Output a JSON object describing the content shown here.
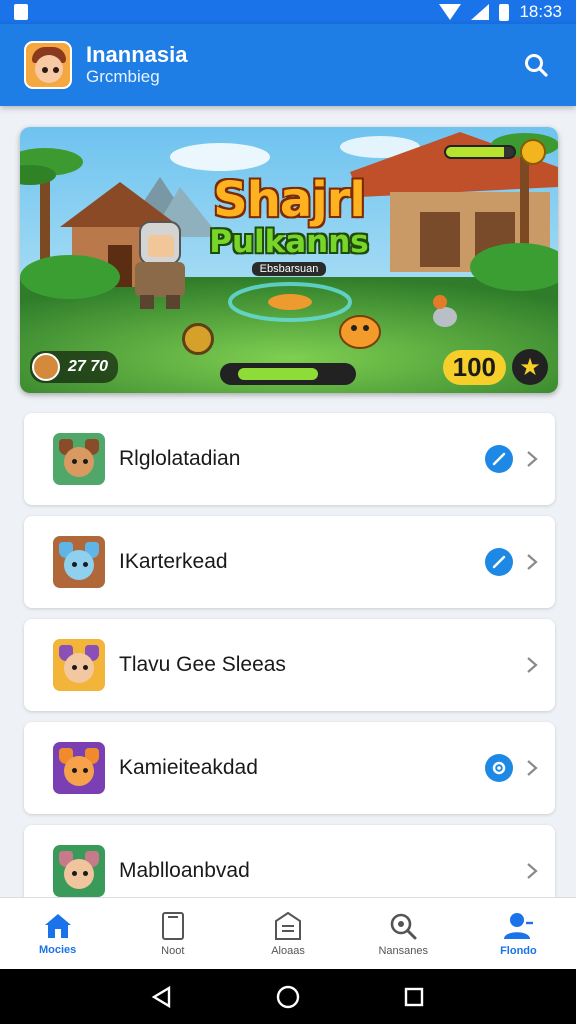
{
  "status_bar": {
    "time": "18:33"
  },
  "app_bar": {
    "title": "Inannasia",
    "subtitle": "Grcmbieg"
  },
  "banner": {
    "title": "Shajrl",
    "subtitle": "Pulkanns",
    "tag": "Ebsbarsuan",
    "hud_left_value": "27 70",
    "hud_right_value": "100",
    "hud_top_fill_percent": 85,
    "hud_center_fill_percent": 80
  },
  "list": {
    "items": [
      {
        "label": "Rlglolatadian",
        "badge": "check"
      },
      {
        "label": "IKarterkead",
        "badge": "check"
      },
      {
        "label": "Tlavu Gee Sleeas",
        "badge": ""
      },
      {
        "label": "Kamieiteakdad",
        "badge": "gear"
      },
      {
        "label": "Mablloanbvad",
        "badge": ""
      }
    ]
  },
  "bottom_nav": {
    "items": [
      {
        "label": "Mocies",
        "icon": "home-icon"
      },
      {
        "label": "Noot",
        "icon": "tablet-icon"
      },
      {
        "label": "Aloaas",
        "icon": "inbox-icon"
      },
      {
        "label": "Nansanes",
        "icon": "search-icon"
      },
      {
        "label": "Flondo",
        "icon": "profile-icon"
      }
    ]
  },
  "colors": {
    "primary": "#1e7ee6",
    "status_bar": "#1a73e8",
    "badge_blue": "#1e88e5",
    "background": "#eef1f5"
  }
}
